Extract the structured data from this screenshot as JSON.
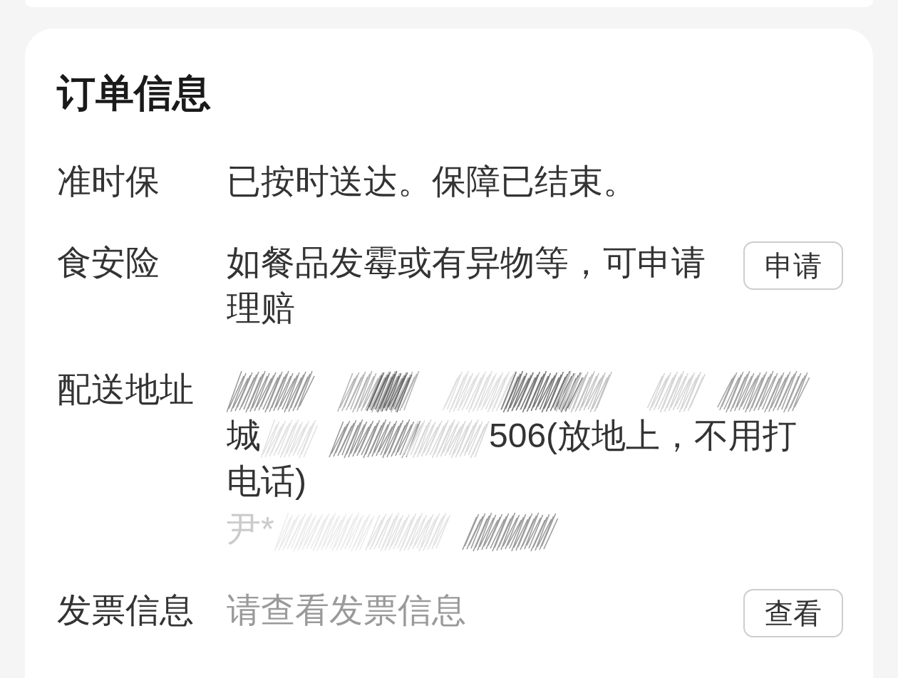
{
  "order_info": {
    "title": "订单信息",
    "rows": [
      {
        "kind": "text",
        "label": "准时保",
        "value": "已按时送达。保障已结束。",
        "muted": false
      },
      {
        "kind": "action",
        "label": "食安险",
        "value": "如餐品发霉或有异物等，可申请理赔",
        "muted": false,
        "button": "申请"
      },
      {
        "kind": "address",
        "label": "配送地址",
        "lines": [
          {
            "segments": [
              {
                "kind": "redacted"
              }
            ]
          },
          {
            "segments": [
              {
                "kind": "text",
                "text": "城",
                "faded": false
              },
              {
                "kind": "redacted"
              },
              {
                "kind": "text",
                "text": "506(放地上，不用打",
                "faded": false
              }
            ]
          },
          {
            "segments": [
              {
                "kind": "text",
                "text": "电话)",
                "faded": false
              }
            ]
          }
        ],
        "contact": {
          "segments": [
            {
              "kind": "text",
              "text": "尹*",
              "faded": true
            },
            {
              "kind": "redacted"
            }
          ]
        }
      },
      {
        "kind": "action",
        "label": "发票信息",
        "value": "请查看发票信息",
        "muted": true,
        "button": "查看"
      }
    ]
  }
}
